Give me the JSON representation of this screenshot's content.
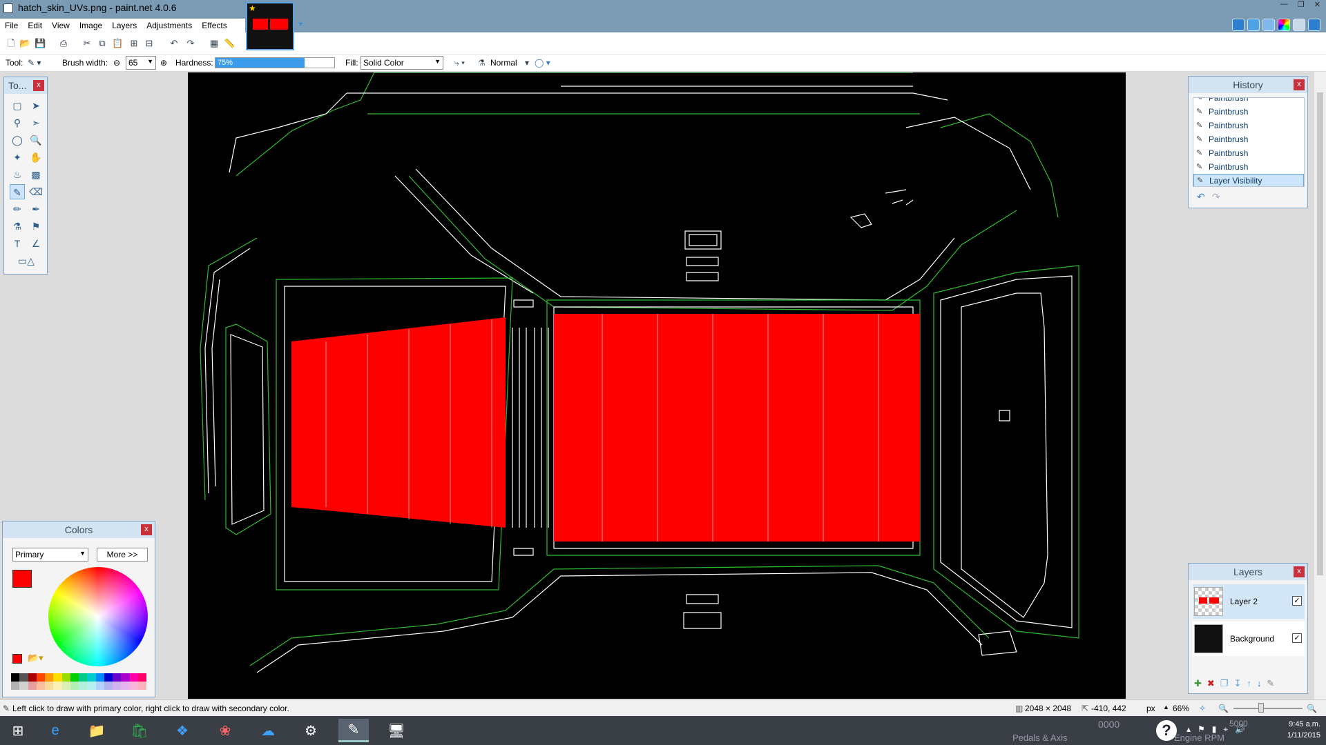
{
  "window": {
    "title": "hatch_skin_UVs.png - paint.net 4.0.6"
  },
  "menu": [
    "File",
    "Edit",
    "View",
    "Image",
    "Layers",
    "Adjustments",
    "Effects"
  ],
  "toolbar": {
    "tool_label": "Tool:",
    "brush_width_label": "Brush width:",
    "brush_width_value": "65",
    "hardness_label": "Hardness:",
    "hardness_value": "75%",
    "hardness_fraction": 0.75,
    "fill_label": "Fill:",
    "fill_value": "Solid Color",
    "blend_mode": "Normal"
  },
  "tools_panel": {
    "title": "To..."
  },
  "history": {
    "title": "History",
    "items": [
      "Paintbrush",
      "Paintbrush",
      "Paintbrush",
      "Paintbrush",
      "Paintbrush",
      "Paintbrush",
      "Layer Visibility"
    ],
    "selected_index": 6
  },
  "colors": {
    "title": "Colors",
    "mode": "Primary",
    "more_button": "More >>",
    "primary_color": "#ff0000",
    "secondary_color": "#ffffff"
  },
  "layers": {
    "title": "Layers",
    "items": [
      {
        "name": "Layer 2",
        "visible": true,
        "selected": true
      },
      {
        "name": "Background",
        "visible": true,
        "selected": false
      }
    ]
  },
  "status": {
    "hint": "Left click to draw with primary color, right click to draw with secondary color.",
    "image_size": "2048 × 2048",
    "cursor_pos": "-410, 442",
    "units": "px",
    "zoom": "66%"
  },
  "taskbar": {
    "time": "9:45 a.m.",
    "date": "1/11/2015",
    "bg_text_1": "0000",
    "bg_text_2": "Pedals & Axis",
    "bg_text_3": "5000",
    "bg_text_4": "Engine RPM"
  }
}
